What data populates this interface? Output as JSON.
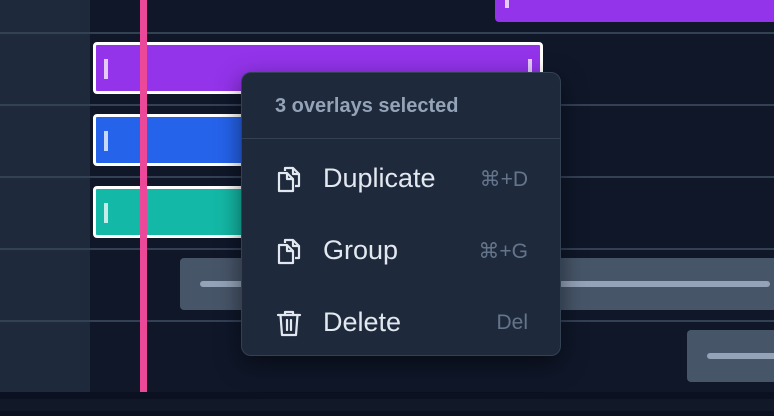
{
  "timeline": {
    "clips": [
      {
        "name": "clip-purple-top",
        "color": "#9333ea",
        "selected": false
      },
      {
        "name": "clip-purple-selected",
        "color": "#9333ea",
        "selected": true
      },
      {
        "name": "clip-blue-selected",
        "color": "#2563eb",
        "selected": true
      },
      {
        "name": "clip-teal-selected",
        "color": "#14b8a6",
        "selected": true
      }
    ],
    "playhead_color": "#ec4899"
  },
  "context_menu": {
    "header": "3 overlays selected",
    "items": [
      {
        "label": "Duplicate",
        "shortcut": "⌘+D",
        "icon": "copy-icon"
      },
      {
        "label": "Group",
        "shortcut": "⌘+G",
        "icon": "copy-icon"
      },
      {
        "label": "Delete",
        "shortcut": "Del",
        "icon": "trash-icon"
      }
    ]
  }
}
